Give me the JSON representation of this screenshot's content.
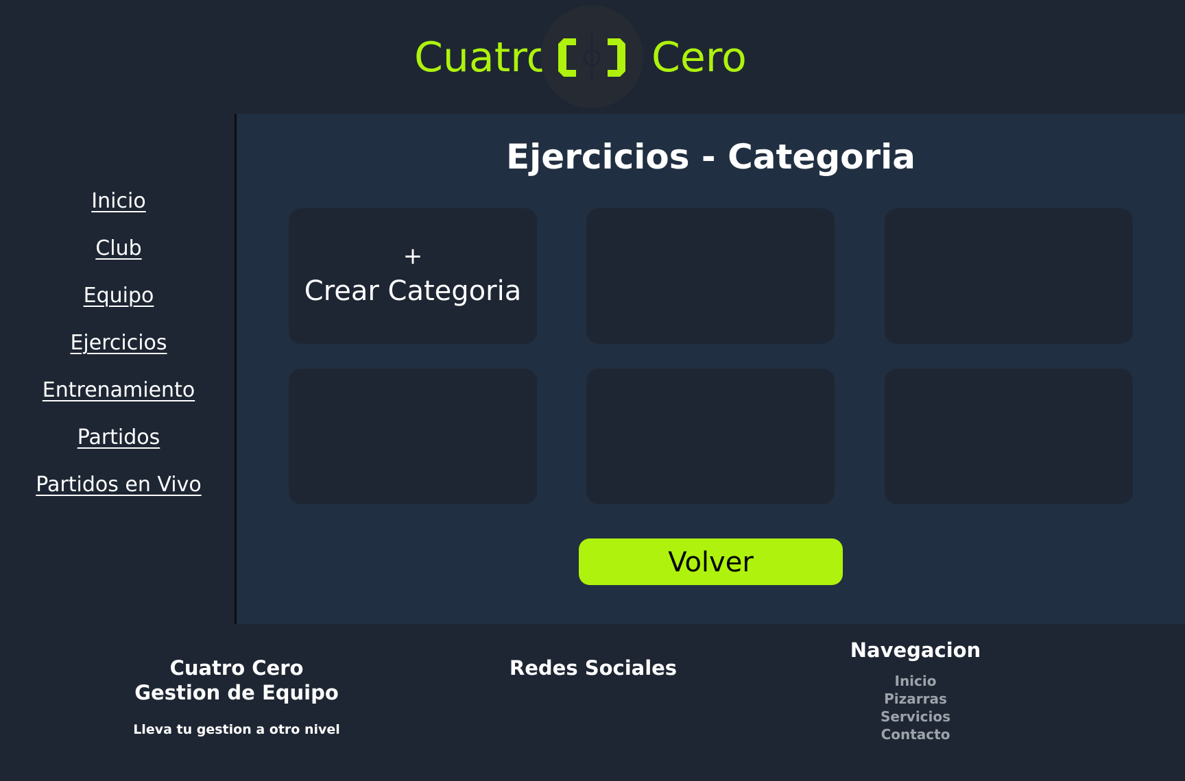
{
  "header": {
    "brand_left": "Cuatro",
    "brand_right": "Cero",
    "logo_icon": "bracket-logo-icon",
    "accent_color": "#aef20d"
  },
  "sidebar": {
    "items": [
      {
        "label": "Inicio"
      },
      {
        "label": "Club"
      },
      {
        "label": "Equipo"
      },
      {
        "label": "Ejercicios"
      },
      {
        "label": "Entrenamiento"
      },
      {
        "label": "Partidos"
      },
      {
        "label": "Partidos en Vivo"
      }
    ]
  },
  "main": {
    "title": "Ejercicios - Categoria",
    "create_card": {
      "plus": "+",
      "label": "Crear Categoria"
    },
    "back_button": "Volver"
  },
  "footer": {
    "brand_line1": "Cuatro Cero",
    "brand_line2": "Gestion de Equipo",
    "tagline": "Lleva tu gestion a otro nivel",
    "social_heading": "Redes Sociales",
    "nav_heading": "Navegacion",
    "nav_items": [
      "Inicio",
      "Pizarras",
      "Servicios",
      "Contacto"
    ]
  }
}
